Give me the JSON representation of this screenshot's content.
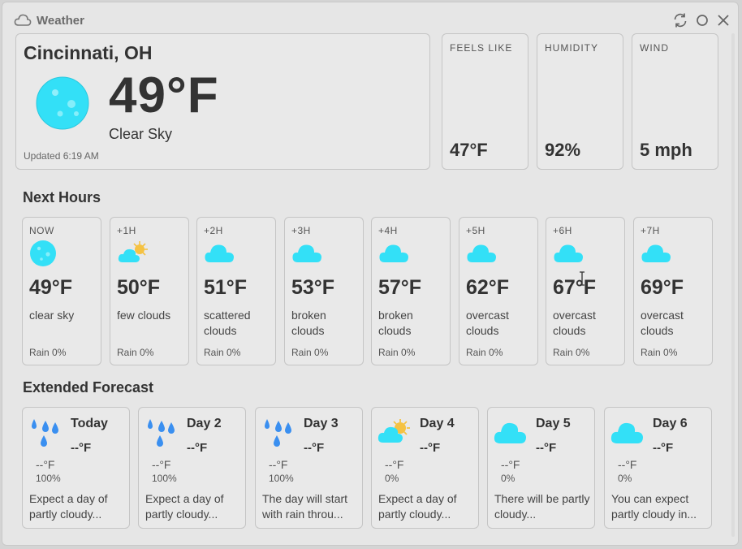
{
  "app": {
    "title": "Weather"
  },
  "current": {
    "city": "Cincinnati, OH",
    "temp": "49°F",
    "description": "Clear Sky",
    "updated": "Updated 6:19 AM",
    "icon": "moon-icon"
  },
  "stats": [
    {
      "label": "FEELS LIKE",
      "value": "47°F"
    },
    {
      "label": "HUMIDITY",
      "value": "92%"
    },
    {
      "label": "WIND",
      "value": "5 mph"
    }
  ],
  "sections": {
    "next_hours": "Next Hours",
    "extended": "Extended Forecast"
  },
  "hours": [
    {
      "label": "NOW",
      "icon": "moon-icon",
      "temp": "49°F",
      "desc": "clear sky",
      "rain": "Rain 0%"
    },
    {
      "label": "+1H",
      "icon": "partly-cloudy-icon",
      "temp": "50°F",
      "desc": "few clouds",
      "rain": "Rain 0%"
    },
    {
      "label": "+2H",
      "icon": "cloud-icon",
      "temp": "51°F",
      "desc": "scattered clouds",
      "rain": "Rain 0%"
    },
    {
      "label": "+3H",
      "icon": "cloud-icon",
      "temp": "53°F",
      "desc": "broken clouds",
      "rain": "Rain 0%"
    },
    {
      "label": "+4H",
      "icon": "cloud-icon",
      "temp": "57°F",
      "desc": "broken clouds",
      "rain": "Rain 0%"
    },
    {
      "label": "+5H",
      "icon": "cloud-icon",
      "temp": "62°F",
      "desc": "overcast clouds",
      "rain": "Rain 0%"
    },
    {
      "label": "+6H",
      "icon": "cloud-icon",
      "temp": "67°F",
      "desc": "overcast clouds",
      "rain": "Rain 0%"
    },
    {
      "label": "+7H",
      "icon": "cloud-icon",
      "temp": "69°F",
      "desc": "overcast clouds",
      "rain": "Rain 0%"
    }
  ],
  "days": [
    {
      "name": "Today",
      "icon": "rain-icon",
      "hi": "--°F",
      "lo": "--°F",
      "pop": "100%",
      "text": "Expect a day of partly cloudy..."
    },
    {
      "name": "Day 2",
      "icon": "rain-icon",
      "hi": "--°F",
      "lo": "--°F",
      "pop": "100%",
      "text": "Expect a day of partly cloudy..."
    },
    {
      "name": "Day 3",
      "icon": "rain-icon",
      "hi": "--°F",
      "lo": "--°F",
      "pop": "100%",
      "text": "The day will start with rain throu..."
    },
    {
      "name": "Day 4",
      "icon": "partly-cloudy-icon",
      "hi": "--°F",
      "lo": "--°F",
      "pop": "0%",
      "text": "Expect a day of partly cloudy..."
    },
    {
      "name": "Day 5",
      "icon": "cloud-icon",
      "hi": "--°F",
      "lo": "--°F",
      "pop": "0%",
      "text": "There will be partly cloudy..."
    },
    {
      "name": "Day 6",
      "icon": "cloud-icon",
      "hi": "--°F",
      "lo": "--°F",
      "pop": "0%",
      "text": "You can expect partly cloudy in..."
    }
  ],
  "colors": {
    "accent": "#33e0f7",
    "sun": "#f5c242"
  }
}
